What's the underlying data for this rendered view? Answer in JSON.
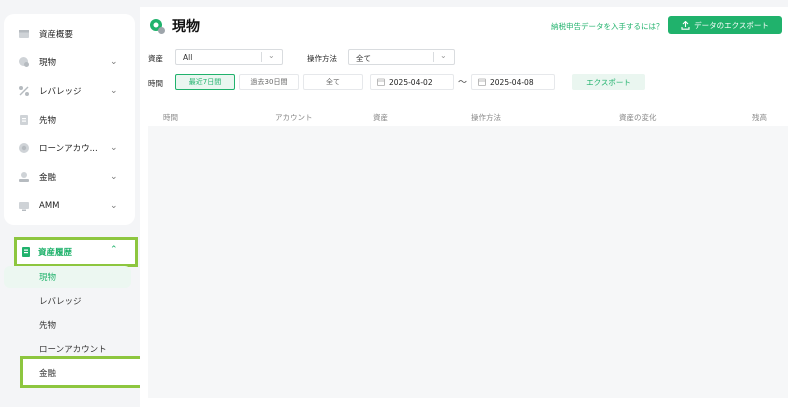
{
  "sidebar": {
    "items": [
      {
        "label": "資産概要",
        "icon": "overview-icon",
        "chevron": ""
      },
      {
        "label": "現物",
        "icon": "spot-icon",
        "chevron": "⌄"
      },
      {
        "label": "レバレッジ",
        "icon": "percent-icon",
        "chevron": "⌄"
      },
      {
        "label": "先物",
        "icon": "futures-icon",
        "chevron": ""
      },
      {
        "label": "ローンアカウ...",
        "icon": "loan-icon",
        "chevron": "⌄"
      },
      {
        "label": "金融",
        "icon": "finance-icon",
        "chevron": "⌄"
      },
      {
        "label": "AMM",
        "icon": "amm-icon",
        "chevron": "⌄"
      }
    ],
    "history": {
      "label": "資産履歴",
      "icon": "history-icon",
      "chevron": "⌃"
    },
    "sub_items": [
      "現物",
      "レバレッジ",
      "先物",
      "ローンアカウント",
      "金融"
    ]
  },
  "header": {
    "title": "現物",
    "tax_link": "納税申告データを入手するには？",
    "export_button": "データのエクスポート"
  },
  "filters": {
    "asset_label": "資産",
    "asset_value": "All",
    "operation_label": "操作方法",
    "operation_value": "全て",
    "time_label": "時間",
    "ranges": [
      "最近7日間",
      "過去30日間",
      "全て"
    ],
    "date_from": "2025-04-02",
    "tilde": "～",
    "date_to": "2025-04-08",
    "export": "エクスポート"
  },
  "table": {
    "columns": [
      "時間",
      "アカウント",
      "資産",
      "操作方法",
      "資産の変化",
      "残高"
    ]
  },
  "colors": {
    "accent": "#20b26c",
    "highlight": "#8dc63f"
  }
}
